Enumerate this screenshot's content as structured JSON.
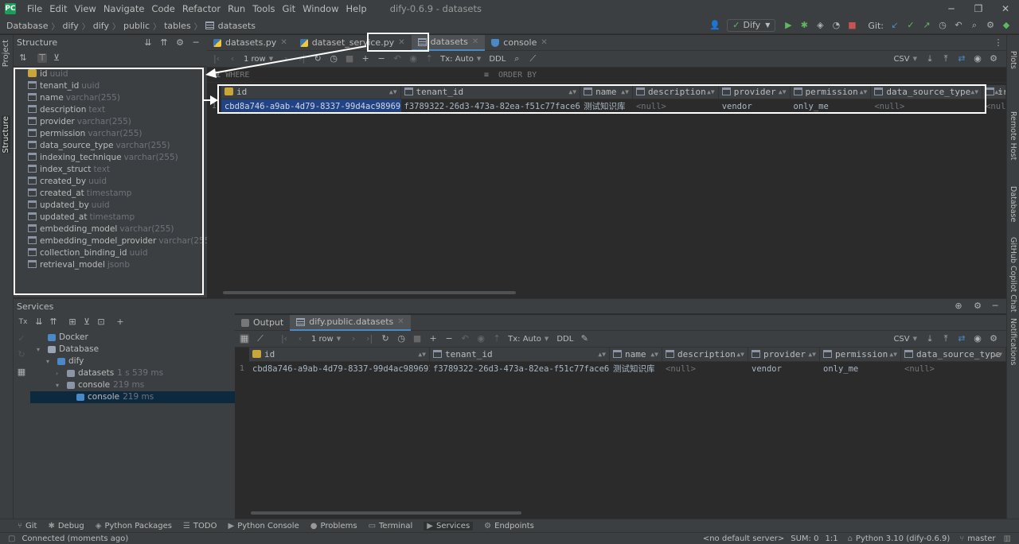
{
  "window": {
    "menu": [
      "File",
      "Edit",
      "View",
      "Navigate",
      "Code",
      "Refactor",
      "Run",
      "Tools",
      "Git",
      "Window",
      "Help"
    ],
    "title": "dify-0.6.9 - datasets"
  },
  "breadcrumb": [
    "Database",
    "dify",
    "dify",
    "public",
    "tables",
    "datasets"
  ],
  "toolbar": {
    "run_config": "Dify",
    "git_label": "Git:"
  },
  "left_stripe": {
    "project": "Project",
    "structure": "Structure"
  },
  "right_stripe": [
    "Plots",
    "Remote Host",
    "Database",
    "GitHub Copilot Chat",
    "Notifications"
  ],
  "structure": {
    "title": "Structure",
    "columns": [
      {
        "name": "id",
        "type": "uuid",
        "key": true
      },
      {
        "name": "tenant_id",
        "type": "uuid"
      },
      {
        "name": "name",
        "type": "varchar(255)"
      },
      {
        "name": "description",
        "type": "text"
      },
      {
        "name": "provider",
        "type": "varchar(255)"
      },
      {
        "name": "permission",
        "type": "varchar(255)"
      },
      {
        "name": "data_source_type",
        "type": "varchar(255)"
      },
      {
        "name": "indexing_technique",
        "type": "varchar(255)"
      },
      {
        "name": "index_struct",
        "type": "text"
      },
      {
        "name": "created_by",
        "type": "uuid"
      },
      {
        "name": "created_at",
        "type": "timestamp"
      },
      {
        "name": "updated_by",
        "type": "uuid"
      },
      {
        "name": "updated_at",
        "type": "timestamp"
      },
      {
        "name": "embedding_model",
        "type": "varchar(255)"
      },
      {
        "name": "embedding_model_provider",
        "type": "varchar(255)"
      },
      {
        "name": "collection_binding_id",
        "type": "uuid"
      },
      {
        "name": "retrieval_model",
        "type": "jsonb"
      }
    ]
  },
  "editor_tabs": [
    {
      "label": "datasets.py",
      "icon": "python-file-icon"
    },
    {
      "label": "dataset_service.py",
      "icon": "python-file-icon"
    },
    {
      "label": "datasets",
      "icon": "table-icon",
      "active": true
    },
    {
      "label": "console",
      "icon": "console-icon"
    }
  ],
  "grid_toolbar": {
    "rows": "1 row",
    "tx": "Tx: Auto",
    "ddl": "DDL",
    "export": "CSV"
  },
  "filter": {
    "where": "WHERE",
    "order_by": "ORDER BY"
  },
  "main_grid": {
    "headers": [
      "id",
      "tenant_id",
      "name",
      "description",
      "provider",
      "permission",
      "data_source_type",
      "ir"
    ],
    "rows": [
      {
        "num": "1",
        "cells": [
          "cbd8a746-a9ab-4d79-8337-99d4ac989691",
          "f3789322-26d3-473a-82ea-f51c77face65",
          "测试知识库",
          "<null>",
          "vendor",
          "only_me",
          "<null>",
          "<nul"
        ]
      }
    ]
  },
  "services": {
    "title": "Services",
    "tree": [
      {
        "label": "Docker",
        "indent": 1,
        "icon": "docker-icon"
      },
      {
        "label": "Database",
        "indent": 1,
        "icon": "folder-icon",
        "expanded": true
      },
      {
        "label": "dify",
        "indent": 2,
        "icon": "postgres-icon",
        "expanded": true
      },
      {
        "label": "datasets",
        "meta": "1 s 539 ms",
        "indent": 3,
        "icon": "session-icon"
      },
      {
        "label": "console",
        "meta": "219 ms",
        "indent": 3,
        "icon": "session-icon",
        "expanded": true
      },
      {
        "label": "console",
        "meta": "219 ms",
        "indent": 4,
        "icon": "console-icon",
        "selected": true
      }
    ],
    "tabs": [
      {
        "label": "Output"
      },
      {
        "label": "dify.public.datasets",
        "active": true
      }
    ],
    "grid": {
      "headers": [
        "id",
        "tenant_id",
        "name",
        "description",
        "provider",
        "permission",
        "data_source_type"
      ],
      "rows": [
        {
          "num": "1",
          "cells": [
            "cbd8a746-a9ab-4d79-8337-99d4ac989691",
            "f3789322-26d3-473a-82ea-f51c77face65",
            "测试知识库",
            "<null>",
            "vendor",
            "only_me",
            "<null>"
          ]
        }
      ]
    }
  },
  "tool_windows": [
    "Git",
    "Debug",
    "Python Packages",
    "TODO",
    "Python Console",
    "Problems",
    "Terminal",
    "Services",
    "Endpoints"
  ],
  "status": {
    "message": "Connected (moments ago)",
    "server": "<no default server>",
    "sum": "SUM: 0",
    "pos": "1:1",
    "interpreter": "Python 3.10 (dify-0.6.9)",
    "branch": "master"
  },
  "colors": {
    "accent": "#4a88c7",
    "selection": "#214283",
    "highlight_box": "#ffffff"
  }
}
